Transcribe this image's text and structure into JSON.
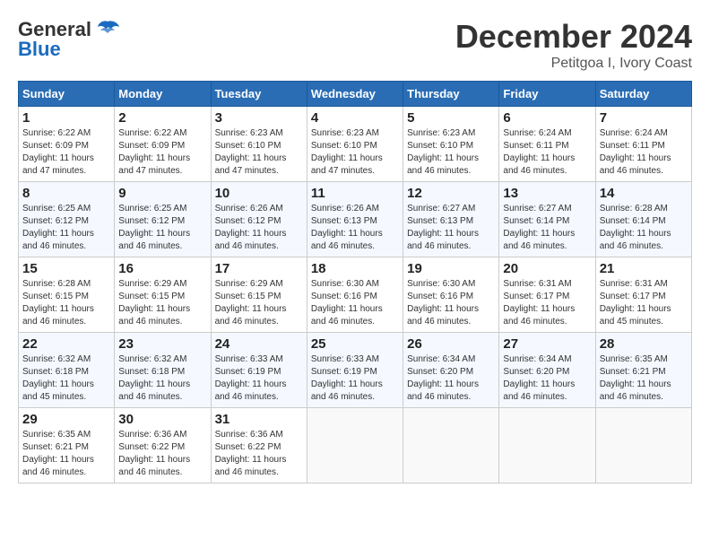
{
  "logo": {
    "general": "General",
    "blue": "Blue"
  },
  "header": {
    "month": "December 2024",
    "location": "Petitgoa I, Ivory Coast"
  },
  "weekdays": [
    "Sunday",
    "Monday",
    "Tuesday",
    "Wednesday",
    "Thursday",
    "Friday",
    "Saturday"
  ],
  "weeks": [
    [
      {
        "day": "1",
        "info": "Sunrise: 6:22 AM\nSunset: 6:09 PM\nDaylight: 11 hours\nand 47 minutes."
      },
      {
        "day": "2",
        "info": "Sunrise: 6:22 AM\nSunset: 6:09 PM\nDaylight: 11 hours\nand 47 minutes."
      },
      {
        "day": "3",
        "info": "Sunrise: 6:23 AM\nSunset: 6:10 PM\nDaylight: 11 hours\nand 47 minutes."
      },
      {
        "day": "4",
        "info": "Sunrise: 6:23 AM\nSunset: 6:10 PM\nDaylight: 11 hours\nand 47 minutes."
      },
      {
        "day": "5",
        "info": "Sunrise: 6:23 AM\nSunset: 6:10 PM\nDaylight: 11 hours\nand 46 minutes."
      },
      {
        "day": "6",
        "info": "Sunrise: 6:24 AM\nSunset: 6:11 PM\nDaylight: 11 hours\nand 46 minutes."
      },
      {
        "day": "7",
        "info": "Sunrise: 6:24 AM\nSunset: 6:11 PM\nDaylight: 11 hours\nand 46 minutes."
      }
    ],
    [
      {
        "day": "8",
        "info": "Sunrise: 6:25 AM\nSunset: 6:12 PM\nDaylight: 11 hours\nand 46 minutes."
      },
      {
        "day": "9",
        "info": "Sunrise: 6:25 AM\nSunset: 6:12 PM\nDaylight: 11 hours\nand 46 minutes."
      },
      {
        "day": "10",
        "info": "Sunrise: 6:26 AM\nSunset: 6:12 PM\nDaylight: 11 hours\nand 46 minutes."
      },
      {
        "day": "11",
        "info": "Sunrise: 6:26 AM\nSunset: 6:13 PM\nDaylight: 11 hours\nand 46 minutes."
      },
      {
        "day": "12",
        "info": "Sunrise: 6:27 AM\nSunset: 6:13 PM\nDaylight: 11 hours\nand 46 minutes."
      },
      {
        "day": "13",
        "info": "Sunrise: 6:27 AM\nSunset: 6:14 PM\nDaylight: 11 hours\nand 46 minutes."
      },
      {
        "day": "14",
        "info": "Sunrise: 6:28 AM\nSunset: 6:14 PM\nDaylight: 11 hours\nand 46 minutes."
      }
    ],
    [
      {
        "day": "15",
        "info": "Sunrise: 6:28 AM\nSunset: 6:15 PM\nDaylight: 11 hours\nand 46 minutes."
      },
      {
        "day": "16",
        "info": "Sunrise: 6:29 AM\nSunset: 6:15 PM\nDaylight: 11 hours\nand 46 minutes."
      },
      {
        "day": "17",
        "info": "Sunrise: 6:29 AM\nSunset: 6:15 PM\nDaylight: 11 hours\nand 46 minutes."
      },
      {
        "day": "18",
        "info": "Sunrise: 6:30 AM\nSunset: 6:16 PM\nDaylight: 11 hours\nand 46 minutes."
      },
      {
        "day": "19",
        "info": "Sunrise: 6:30 AM\nSunset: 6:16 PM\nDaylight: 11 hours\nand 46 minutes."
      },
      {
        "day": "20",
        "info": "Sunrise: 6:31 AM\nSunset: 6:17 PM\nDaylight: 11 hours\nand 46 minutes."
      },
      {
        "day": "21",
        "info": "Sunrise: 6:31 AM\nSunset: 6:17 PM\nDaylight: 11 hours\nand 45 minutes."
      }
    ],
    [
      {
        "day": "22",
        "info": "Sunrise: 6:32 AM\nSunset: 6:18 PM\nDaylight: 11 hours\nand 45 minutes."
      },
      {
        "day": "23",
        "info": "Sunrise: 6:32 AM\nSunset: 6:18 PM\nDaylight: 11 hours\nand 46 minutes."
      },
      {
        "day": "24",
        "info": "Sunrise: 6:33 AM\nSunset: 6:19 PM\nDaylight: 11 hours\nand 46 minutes."
      },
      {
        "day": "25",
        "info": "Sunrise: 6:33 AM\nSunset: 6:19 PM\nDaylight: 11 hours\nand 46 minutes."
      },
      {
        "day": "26",
        "info": "Sunrise: 6:34 AM\nSunset: 6:20 PM\nDaylight: 11 hours\nand 46 minutes."
      },
      {
        "day": "27",
        "info": "Sunrise: 6:34 AM\nSunset: 6:20 PM\nDaylight: 11 hours\nand 46 minutes."
      },
      {
        "day": "28",
        "info": "Sunrise: 6:35 AM\nSunset: 6:21 PM\nDaylight: 11 hours\nand 46 minutes."
      }
    ],
    [
      {
        "day": "29",
        "info": "Sunrise: 6:35 AM\nSunset: 6:21 PM\nDaylight: 11 hours\nand 46 minutes."
      },
      {
        "day": "30",
        "info": "Sunrise: 6:36 AM\nSunset: 6:22 PM\nDaylight: 11 hours\nand 46 minutes."
      },
      {
        "day": "31",
        "info": "Sunrise: 6:36 AM\nSunset: 6:22 PM\nDaylight: 11 hours\nand 46 minutes."
      },
      {
        "day": "",
        "info": ""
      },
      {
        "day": "",
        "info": ""
      },
      {
        "day": "",
        "info": ""
      },
      {
        "day": "",
        "info": ""
      }
    ]
  ]
}
